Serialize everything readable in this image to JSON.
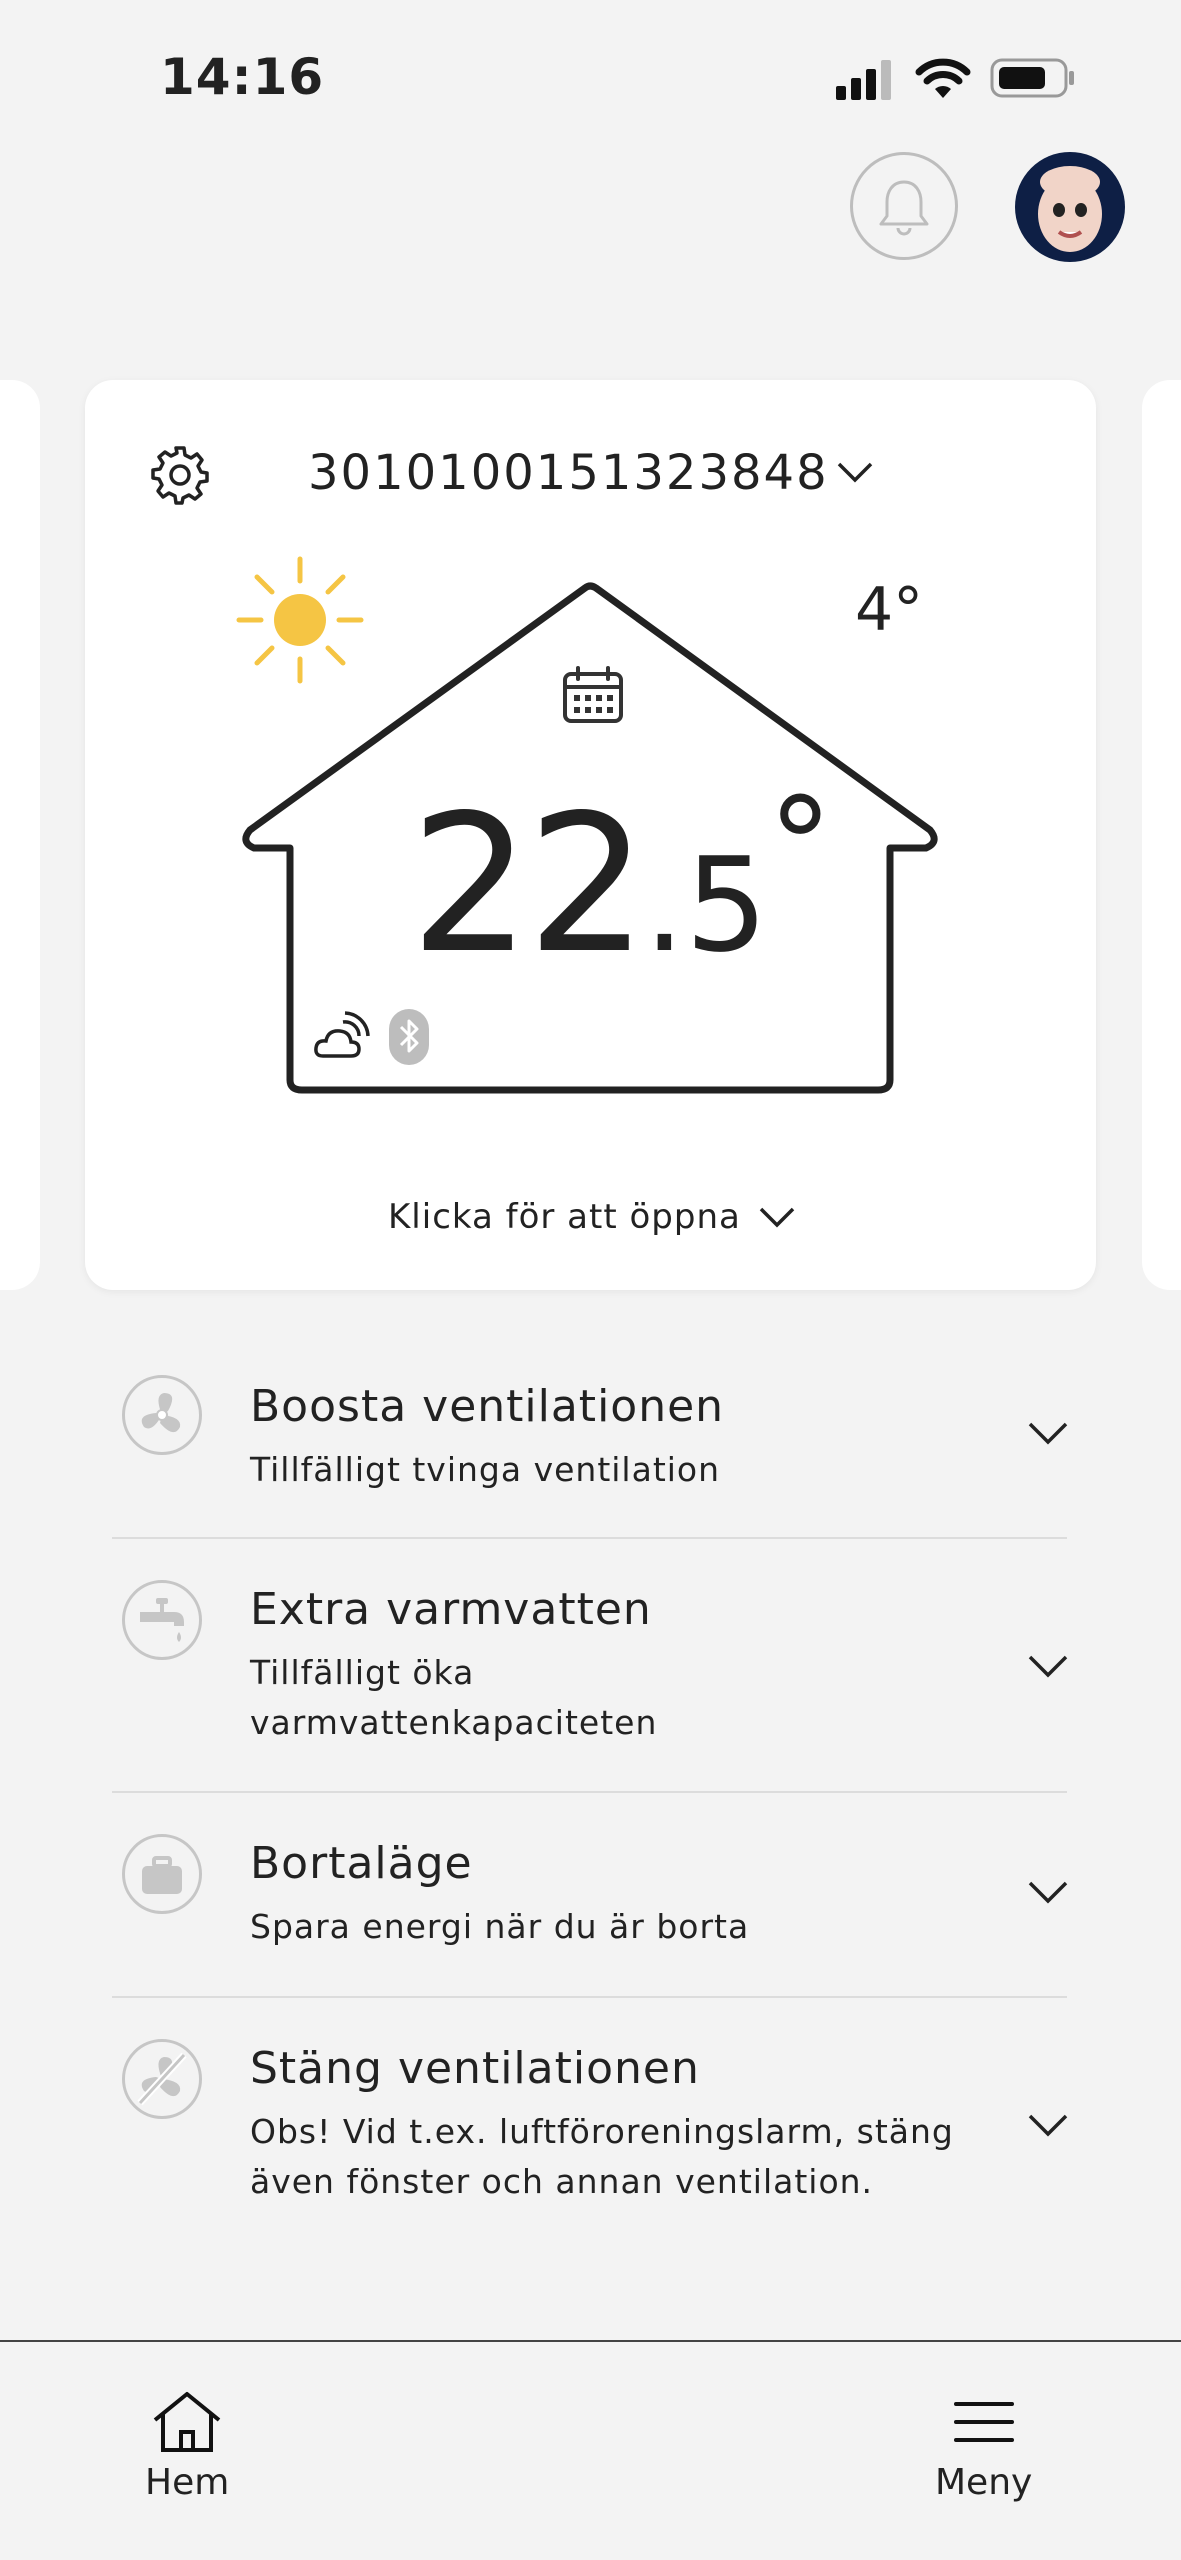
{
  "status_bar": {
    "time": "14:16"
  },
  "device": {
    "id": "3010100151323848",
    "outdoor_temp": "4°",
    "indoor_temp_int": "22",
    "indoor_temp_dec": ".5",
    "degree": "°",
    "open_label": "Klicka för att öppna"
  },
  "actions": [
    {
      "title": "Boosta ventilationen",
      "subtitle": "Tillfälligt tvinga ventilation",
      "icon": "fan-icon"
    },
    {
      "title": "Extra varmvatten",
      "subtitle_line1": "Tillfälligt öka",
      "subtitle_line2": "varmvattenkapaciteten",
      "icon": "faucet-icon"
    },
    {
      "title": "Bortaläge",
      "subtitle": "Spara energi när du är borta",
      "icon": "suitcase-icon"
    },
    {
      "title": "Stäng ventilationen",
      "subtitle_line1": "Obs! Vid t.ex. luftföroreningslarm, stäng",
      "subtitle_line2": "även fönster och annan ventilation.",
      "icon": "fan-off-icon"
    }
  ],
  "nav": {
    "home": "Hem",
    "menu": "Meny"
  },
  "colors": {
    "sun": "#F5C544",
    "background": "#F3F3F3",
    "card": "#FFFFFF"
  }
}
